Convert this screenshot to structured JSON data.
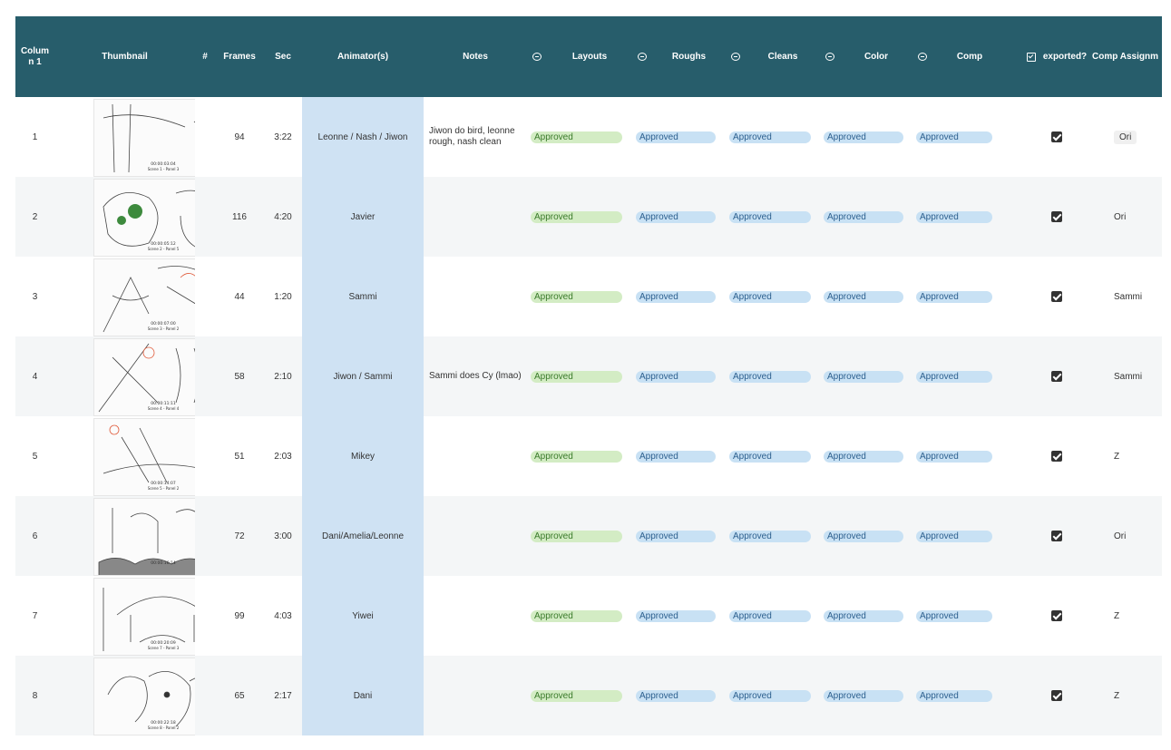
{
  "headers": {
    "col1_line1": "Colum",
    "col1_line2": "n 1",
    "thumbnail": "Thumbnail",
    "hash": "#",
    "frames": "Frames",
    "sec": "Sec",
    "animators": "Animator(s)",
    "notes": "Notes",
    "layouts": "Layouts",
    "roughs": "Roughs",
    "cleans": "Cleans",
    "color": "Color",
    "comp": "Comp",
    "exported": "exported?",
    "comp_assign": "Comp Assignm"
  },
  "rows": [
    {
      "n": "1",
      "frames": "94",
      "sec": "3:22",
      "animators": "Leonne / Nash / Jiwon",
      "notes": "Jiwon do bird, leonne rough, nash clean",
      "layouts": "Approved",
      "roughs": "Approved",
      "cleans": "Approved",
      "color": "Approved",
      "comp": "Approved",
      "exported": true,
      "assign": "Ori",
      "thumb_time": "00:00:03:04",
      "thumb_scene": "Scene 1 - Panel 3"
    },
    {
      "n": "2",
      "frames": "116",
      "sec": "4:20",
      "animators": "Javier",
      "notes": "",
      "layouts": "Approved",
      "roughs": "Approved",
      "cleans": "Approved",
      "color": "Approved",
      "comp": "Approved",
      "exported": true,
      "assign": "Ori",
      "thumb_time": "00:00:05:12",
      "thumb_scene": "Scene 2 - Panel 5"
    },
    {
      "n": "3",
      "frames": "44",
      "sec": "1:20",
      "animators": "Sammi",
      "notes": "",
      "layouts": "Approved",
      "roughs": "Approved",
      "cleans": "Approved",
      "color": "Approved",
      "comp": "Approved",
      "exported": true,
      "assign": "Sammi",
      "thumb_time": "00:00:07:00",
      "thumb_scene": "Scene 3 - Panel 2"
    },
    {
      "n": "4",
      "frames": "58",
      "sec": "2:10",
      "animators": "Jiwon / Sammi",
      "notes": "Sammi does Cy (lmao)",
      "layouts": "Approved",
      "roughs": "Approved",
      "cleans": "Approved",
      "color": "Approved",
      "comp": "Approved",
      "exported": true,
      "assign": "Sammi",
      "thumb_time": "00:00:11:11",
      "thumb_scene": "Scene 4 - Panel 4"
    },
    {
      "n": "5",
      "frames": "51",
      "sec": "2:03",
      "animators": "Mikey",
      "notes": "",
      "layouts": "Approved",
      "roughs": "Approved",
      "cleans": "Approved",
      "color": "Approved",
      "comp": "Approved",
      "exported": true,
      "assign": "Z",
      "thumb_time": "00:00:14:07",
      "thumb_scene": "Scene 5 - Panel 2"
    },
    {
      "n": "6",
      "frames": "72",
      "sec": "3:00",
      "animators": "Dani/Amelia/Leonne",
      "notes": "",
      "layouts": "Approved",
      "roughs": "Approved",
      "cleans": "Approved",
      "color": "Approved",
      "comp": "Approved",
      "exported": true,
      "assign": "Ori",
      "thumb_time": "00:00:16:14",
      "thumb_scene": ""
    },
    {
      "n": "7",
      "frames": "99",
      "sec": "4:03",
      "animators": "Yiwei",
      "notes": "",
      "layouts": "Approved",
      "roughs": "Approved",
      "cleans": "Approved",
      "color": "Approved",
      "comp": "Approved",
      "exported": true,
      "assign": "Z",
      "thumb_time": "00:00:20:09",
      "thumb_scene": "Scene 7 - Panel 3"
    },
    {
      "n": "8",
      "frames": "65",
      "sec": "2:17",
      "animators": "Dani",
      "notes": "",
      "layouts": "Approved",
      "roughs": "Approved",
      "cleans": "Approved",
      "color": "Approved",
      "comp": "Approved",
      "exported": true,
      "assign": "Z",
      "thumb_time": "00:00:22:18",
      "thumb_scene": "Scene 8 - Panel 2"
    }
  ],
  "colors": {
    "header": "#275d6b",
    "approved_green": "#d3ecc4",
    "approved_blue": "#c8e1f4",
    "animator_col": "#cfe2f3"
  },
  "icons": {
    "status_header_icon": "circle-dash-icon",
    "exported_header_icon": "checkbox-icon"
  }
}
